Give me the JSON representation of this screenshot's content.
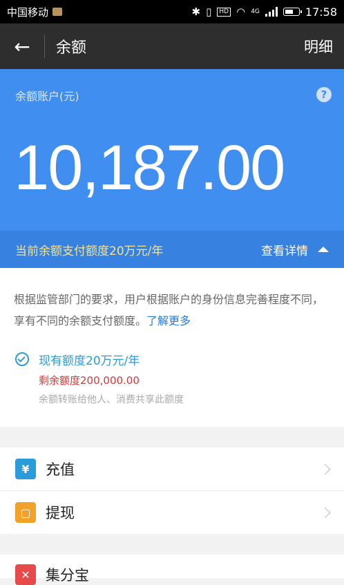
{
  "status_bar": {
    "carrier": "中国移动",
    "network": "4G",
    "hd": "HD",
    "time": "17:58"
  },
  "header": {
    "title": "余额",
    "detail_label": "明细"
  },
  "balance": {
    "label": "余额账户(元)",
    "help": "?",
    "amount": "10,187.00"
  },
  "quota_bar": {
    "text": "当前余额支付额度20万元/年",
    "more": "查看详情"
  },
  "info": {
    "description": "根据监管部门的要求，用户根据账户的身份信息完善程度不同，享有不同的余额支付额度。",
    "link": "了解更多",
    "limit": "现有额度20万元/年",
    "remaining": "剩余额度200,000.00",
    "note": "余额转账给他人、消费共享此额度"
  },
  "menu": [
    {
      "label": "充值",
      "icon_char": "¥",
      "icon_color": "#2b9bd9"
    },
    {
      "label": "提现",
      "icon_char": "▢",
      "icon_color": "#f0a22b"
    },
    {
      "label": "集分宝",
      "icon_char": "✕",
      "icon_color": "#e64a4a"
    }
  ],
  "colors": {
    "hero_blue": "#3f8ef0",
    "quota_yellow": "#fce38a",
    "link_blue": "#2b7bd9"
  }
}
